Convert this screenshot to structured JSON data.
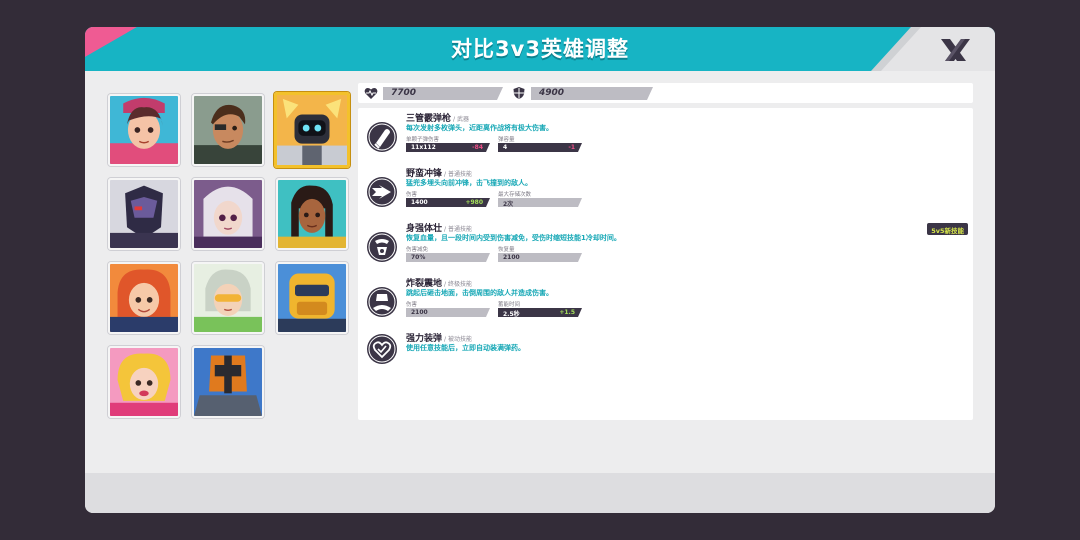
{
  "header": {
    "title": "对比3v3英雄调整",
    "colors": {
      "primary": "#17b4c4",
      "accent": "#ef5b93",
      "highlight": "#f3c12b"
    }
  },
  "heroes": [
    {
      "id": "hero-1",
      "selected": false
    },
    {
      "id": "hero-2",
      "selected": false
    },
    {
      "id": "hero-3",
      "selected": true
    },
    {
      "id": "hero-4",
      "selected": false
    },
    {
      "id": "hero-5",
      "selected": false
    },
    {
      "id": "hero-6",
      "selected": false
    },
    {
      "id": "hero-7",
      "selected": false
    },
    {
      "id": "hero-8",
      "selected": false
    },
    {
      "id": "hero-9",
      "selected": false
    },
    {
      "id": "hero-10",
      "selected": false
    },
    {
      "id": "hero-11",
      "selected": false
    }
  ],
  "stats": {
    "health_icon": "heart-pulse-icon",
    "health": "7700",
    "shield_icon": "shield-icon",
    "shield": "4900"
  },
  "badge": "5v5新技能",
  "skills": [
    {
      "icon": "bullet-icon",
      "name": "三管霰弹枪",
      "type": "/ 武器",
      "desc": "每次发射多枚弹头，近距离作战将有极大伤害。",
      "stat1": {
        "label": "单颗子弹伤害",
        "value": "11x112",
        "delta": "-84",
        "dark": true
      },
      "stat2": {
        "label": "弹容量",
        "value": "4",
        "delta": "-1",
        "dark": true
      }
    },
    {
      "icon": "dash-icon",
      "name": "野蛮冲锋",
      "type": "/ 普通技能",
      "desc": "猛兜多埋头向前冲锋，击飞撞到的敌人。",
      "stat1": {
        "label": "伤害",
        "value": "1400",
        "delta": "+980",
        "dark": true
      },
      "stat2": {
        "label": "最大存储次数",
        "value": "2次",
        "delta": "",
        "dark": false
      }
    },
    {
      "icon": "fortify-icon",
      "name": "身强体壮",
      "type": "/ 普通技能",
      "desc": "恢复血量，且一段时间内受到伤害减免，受伤时缩短技能1冷却时间。",
      "stat1": {
        "label": "伤害减免",
        "value": "70%",
        "delta": "",
        "dark": false
      },
      "stat2": {
        "label": "恢复量",
        "value": "2100",
        "delta": "",
        "dark": false
      }
    },
    {
      "icon": "slam-icon",
      "name": "炸裂震地",
      "type": "/ 终极技能",
      "desc": "跳起后砸击地面，击倒周围的敌人并造成伤害。",
      "stat1": {
        "label": "伤害",
        "value": "2100",
        "delta": "",
        "dark": false
      },
      "stat2": {
        "label": "蓄能时间",
        "value": "2.5秒",
        "delta": "+1.5",
        "dark": true
      }
    },
    {
      "icon": "reload-icon",
      "name": "强力装弹",
      "type": "/ 被动技能",
      "desc": "使用任意技能后，立即自动装满弹药。",
      "stat1": null,
      "stat2": null
    }
  ]
}
